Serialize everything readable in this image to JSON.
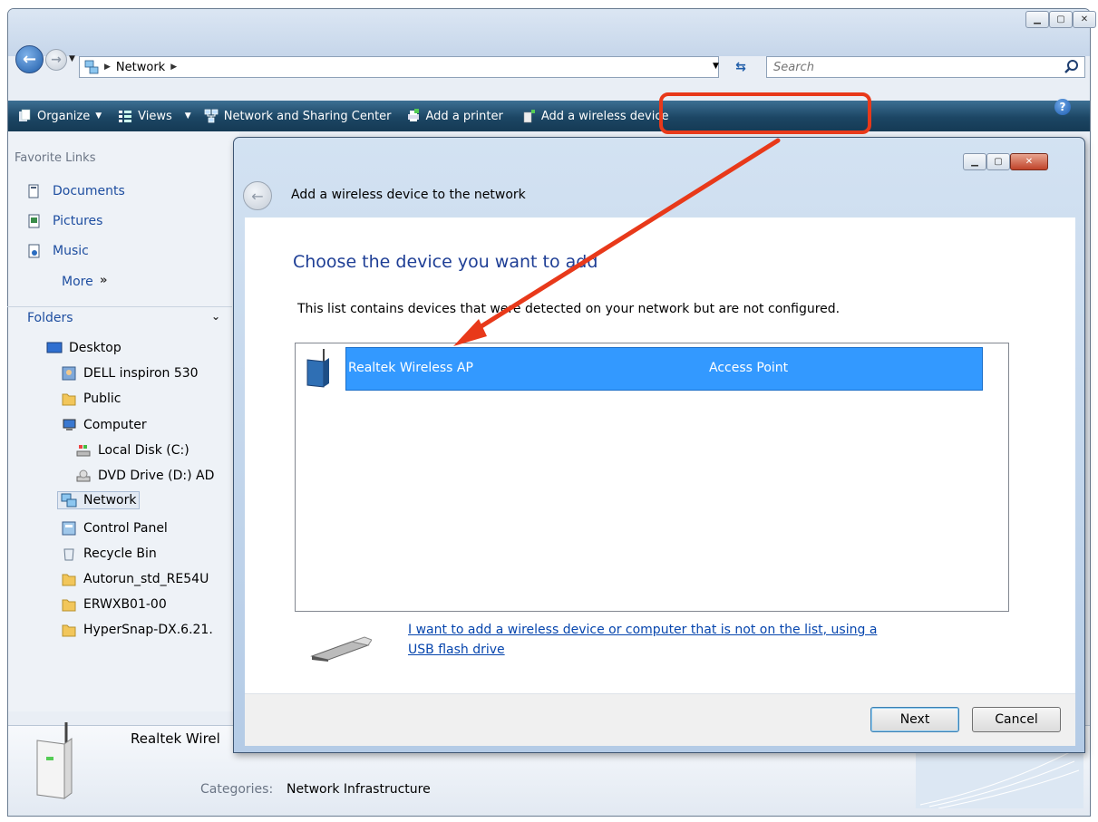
{
  "explorer": {
    "address": {
      "crumb": "Network"
    },
    "search": {
      "placeholder": "Search"
    },
    "toolbar": {
      "organize": "Organize",
      "views": "Views",
      "network_center": "Network and Sharing Center",
      "add_printer": "Add a printer",
      "add_wireless": "Add a wireless device"
    },
    "favorites": {
      "title": "Favorite Links",
      "items": [
        "Documents",
        "Pictures",
        "Music"
      ],
      "more": "More"
    },
    "folders": {
      "title": "Folders",
      "tree": [
        "Desktop",
        "DELL inspiron 530",
        "Public",
        "Computer",
        "Local Disk (C:)",
        "DVD Drive (D:) AD",
        "Network",
        "Control Panel",
        "Recycle Bin",
        "Autorun_std_RE54U",
        "ERWXB01-00",
        "HyperSnap-DX.6.21."
      ]
    },
    "details": {
      "name": "Realtek Wirel",
      "categories_label": "Categories:",
      "categories_value": "Network Infrastructure"
    }
  },
  "dialog": {
    "title": "Add a wireless device to the network",
    "heading": "Choose the device you want to add",
    "description": "This list contains devices that were detected on your network but are not configured.",
    "devices": [
      {
        "name": "Realtek Wireless AP",
        "type": "Access Point",
        "selected": true
      }
    ],
    "usb_link_line1": "I want to add a wireless device or computer that is not on the list, using a",
    "usb_link_line2": "USB flash drive",
    "next": "Next",
    "cancel": "Cancel"
  },
  "colors": {
    "toolbar": "#1c4664",
    "selection": "#3399ff",
    "link": "#1e4ea0",
    "annotation": "#e8391a"
  }
}
